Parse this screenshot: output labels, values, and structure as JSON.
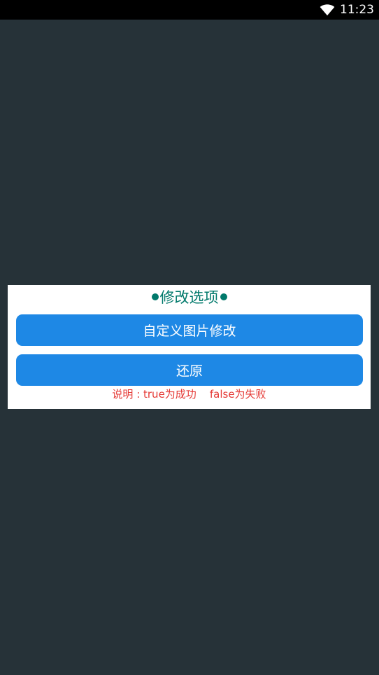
{
  "status_bar": {
    "time": "11:23",
    "wifi_icon": "wifi-icon"
  },
  "dialog": {
    "title": "修改选项",
    "title_color": "#00796b",
    "buttons": [
      {
        "label": "自定义图片修改",
        "color": "#1e88e5"
      },
      {
        "label": "还原",
        "color": "#1e88e5"
      }
    ],
    "note": "说明 : true为成功    false为失败",
    "note_color": "#e53935"
  }
}
